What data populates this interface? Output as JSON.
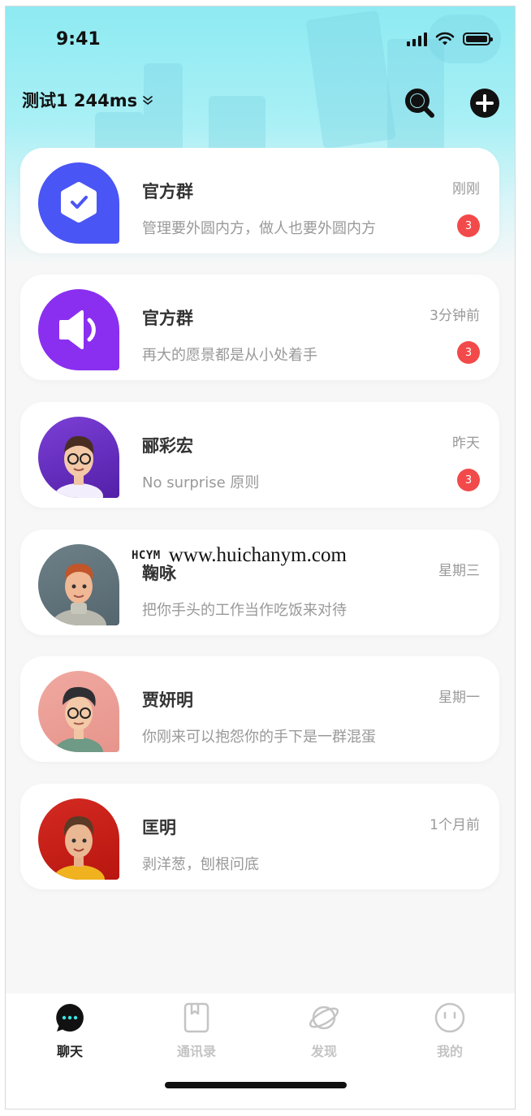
{
  "status_bar": {
    "time": "9:41"
  },
  "header": {
    "title": "测试1 244ms"
  },
  "chats": [
    {
      "name": "官方群",
      "message": "管理要外圆内方，做人也要外圆内方",
      "time": "刚刚",
      "badge": "3",
      "avatar_icon": "verified-check-icon"
    },
    {
      "name": "官方群",
      "message": "再大的愿景都是从小处着手",
      "time": "3分钟前",
      "badge": "3",
      "avatar_icon": "speaker-icon"
    },
    {
      "name": "郦彩宏",
      "message": "No surprise 原则",
      "time": "昨天",
      "badge": "3",
      "avatar_icon": "user-avatar"
    },
    {
      "name": "鞠咏",
      "message": "把你手头的工作当作吃饭来对待",
      "time": "星期三",
      "badge": "",
      "avatar_icon": "user-avatar"
    },
    {
      "name": "贾妍明",
      "message": "你刚来可以抱怨你的手下是一群混蛋",
      "time": "星期一",
      "badge": "",
      "avatar_icon": "user-avatar"
    },
    {
      "name": "匡明",
      "message": "剥洋葱，刨根问底",
      "time": "1个月前",
      "badge": "",
      "avatar_icon": "user-avatar"
    }
  ],
  "watermark": {
    "logo": "HCYM",
    "url": "www.huichanym.com"
  },
  "tabs": [
    {
      "label": "聊天",
      "icon": "chat-bubble-icon",
      "active": true
    },
    {
      "label": "通讯录",
      "icon": "contacts-book-icon",
      "active": false
    },
    {
      "label": "发现",
      "icon": "planet-icon",
      "active": false
    },
    {
      "label": "我的",
      "icon": "smiley-face-icon",
      "active": false
    }
  ],
  "colors": {
    "badge": "#f24a4a",
    "official_blue": "#4a55f5",
    "official_purple": "#8a2ff0",
    "hero_cyan": "#8eeaf2"
  }
}
